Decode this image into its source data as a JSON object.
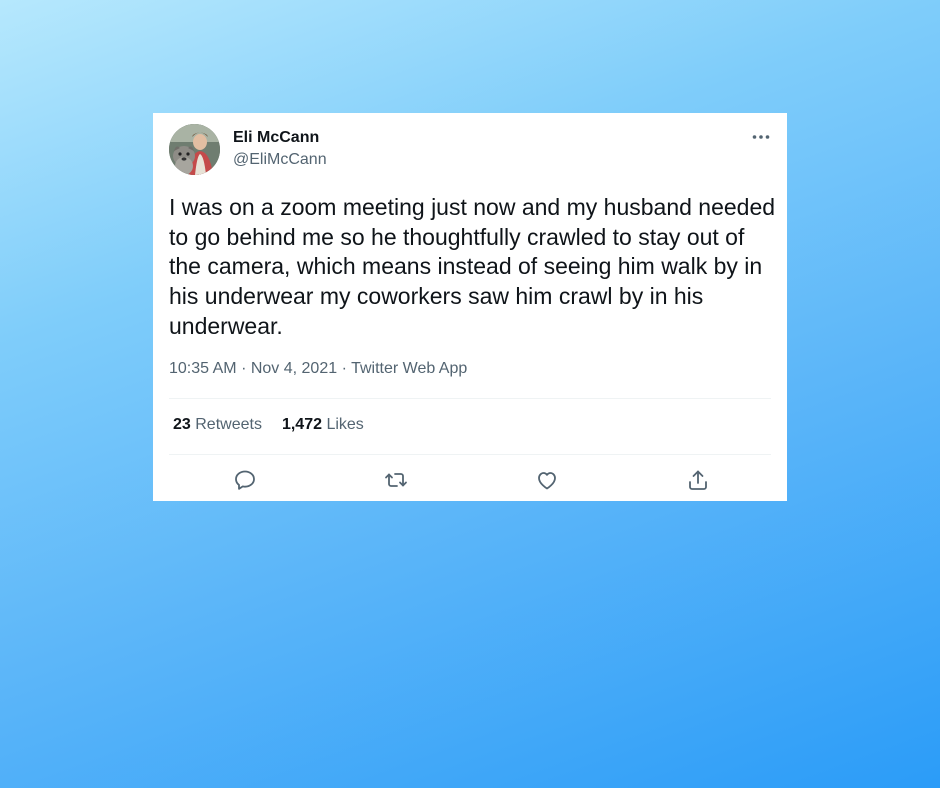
{
  "background": {
    "gradient_colors": [
      "#b6e8fd",
      "#7fcdfa",
      "#5cb6f9",
      "#2b9cf8"
    ]
  },
  "tweet": {
    "author": {
      "name": "Eli McCann",
      "handle": "@EliMcCann",
      "avatar_icon": "profile-photo"
    },
    "text": "I was on a zoom meeting just now and my husband needed to go behind me so he thoughtfully crawled to stay out of the camera, which means instead of seeing him walk by in his underwear my coworkers saw him crawl by in his underwear.",
    "time": "10:35 AM",
    "separator": "·",
    "date": "Nov 4, 2021",
    "source": "Twitter Web App",
    "stats": {
      "retweets_count": "23",
      "retweets_label": "Retweets",
      "likes_count": "1,472",
      "likes_label": "Likes"
    },
    "actions": [
      {
        "name": "reply",
        "icon": "reply-icon"
      },
      {
        "name": "retweet",
        "icon": "retweet-icon"
      },
      {
        "name": "like",
        "icon": "heart-icon"
      },
      {
        "name": "share",
        "icon": "share-icon"
      }
    ],
    "colors": {
      "text_primary": "#0f1419",
      "text_secondary": "#536471",
      "divider": "#eff3f4"
    }
  }
}
